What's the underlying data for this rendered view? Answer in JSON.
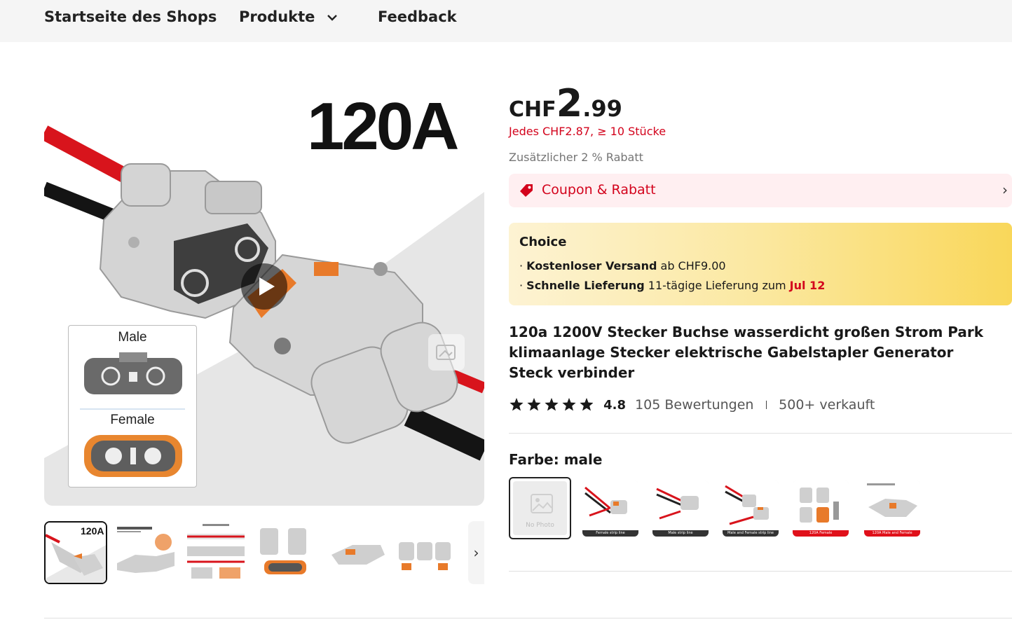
{
  "nav": {
    "home": "Startseite des Shops",
    "products": "Produkte",
    "feedback": "Feedback"
  },
  "gallery": {
    "main_label": "120A",
    "inset_male": "Male",
    "inset_female": "Female",
    "thumb_label": "120A",
    "thumb_count": 6,
    "active_thumb": 0
  },
  "price": {
    "currency": "CHF",
    "integer": "2",
    "decimal": ".99",
    "bulk": "Jedes CHF2.87, ≥ 10 Stücke",
    "extra_discount": "Zusätzlicher 2 % Rabatt"
  },
  "coupon": {
    "label": "Coupon & Rabatt"
  },
  "choice": {
    "title": "Choice",
    "shipping_bold": "Kostenloser Versand",
    "shipping_rest": " ab CHF9.00",
    "delivery_bold": "Schnelle Lieferung",
    "delivery_rest": " 11-tägige Lieferung zum ",
    "delivery_date": "Jul 12"
  },
  "product": {
    "title": "120a 1200V Stecker Buchse wasserdicht großen Strom Park klimaanlage Stecker elektrische Gabelstapler Generator Steck verbinder",
    "rating": "4.8",
    "stars": 5,
    "reviews": "105 Bewertungen",
    "sold": "500+ verkauft"
  },
  "variants": {
    "label": "Farbe: male",
    "no_photo": "No Photo",
    "options": [
      {
        "caption": "Female strip line",
        "cap_color": "#333333"
      },
      {
        "caption": "Male strip line",
        "cap_color": "#333333"
      },
      {
        "caption": "Male and Female strip line",
        "cap_color": "#333333"
      },
      {
        "caption": "120A Female",
        "cap_color": "#e0101a"
      },
      {
        "caption": "120A Male and Female",
        "cap_color": "#e0101a"
      }
    ]
  },
  "colors": {
    "accent_red": "#d3031c",
    "coupon_bg": "#ffeff1"
  }
}
